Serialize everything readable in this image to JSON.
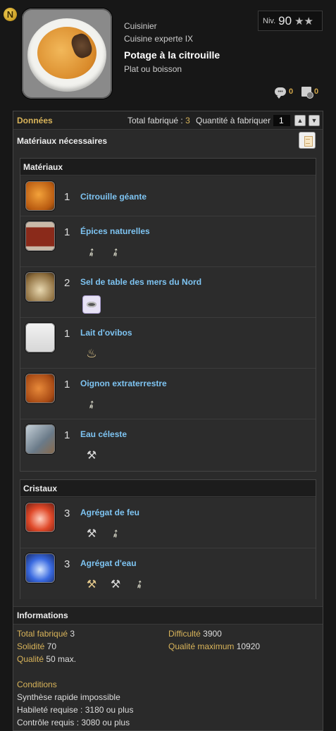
{
  "header": {
    "job": "Cuisinier",
    "category": "Cuisine experte IX",
    "recipe_name": "Potage à la citrouille",
    "item_type": "Plat ou boisson",
    "level_label": "Niv.",
    "level_value": "90",
    "stars": "★★",
    "comments_count": "0",
    "bookmarks_count": "0"
  },
  "toolbar": {
    "tab_label": "Données",
    "total_label": "Total fabriqué :",
    "total_value": "3",
    "quantity_label": "Quantité à fabriquer",
    "quantity_value": "1"
  },
  "materials_section": {
    "title": "Matériaux nécessaires"
  },
  "materials": {
    "title": "Matériaux",
    "items": [
      {
        "qty": "1",
        "name": "Citrouille géante",
        "sources": []
      },
      {
        "qty": "1",
        "name": "Épices naturelles",
        "sources": [
          "feather-icon",
          "feather-icon"
        ]
      },
      {
        "qty": "2",
        "name": "Sel de table des mers du Nord",
        "sources": [
          "vendor-box-icon"
        ]
      },
      {
        "qty": "1",
        "name": "Lait d'ovibos",
        "sources": [
          "pouch-icon"
        ]
      },
      {
        "qty": "1",
        "name": "Oignon extraterrestre",
        "sources": [
          "feather-icon"
        ]
      },
      {
        "qty": "1",
        "name": "Eau céleste",
        "sources": [
          "pickaxe-icon"
        ]
      }
    ]
  },
  "crystals": {
    "title": "Cristaux",
    "items": [
      {
        "qty": "3",
        "name": "Agrégat de feu",
        "sources": [
          "pickaxe-icon",
          "feather-icon"
        ]
      },
      {
        "qty": "3",
        "name": "Agrégat d'eau",
        "sources": [
          "pickaxe-icon",
          "pickaxe-icon",
          "feather-icon"
        ]
      }
    ]
  },
  "informations": {
    "title": "Informations",
    "total_label": "Total fabriqué",
    "total_value": "3",
    "difficulty_label": "Difficulté",
    "difficulty_value": "3900",
    "durability_label": "Solidité",
    "durability_value": "70",
    "max_quality_label": "Qualité maximum",
    "max_quality_value": "10920",
    "quality_label": "Qualité",
    "quality_value": "50 max.",
    "conditions_label": "Conditions",
    "conditions": [
      "Synthèse rapide impossible",
      "Habileté requise : 3180 ou plus",
      "Contrôle requis : 3080 ou plus"
    ]
  },
  "colors": {
    "accent_gold": "#d9b45a",
    "link_blue": "#7ec4f2"
  }
}
